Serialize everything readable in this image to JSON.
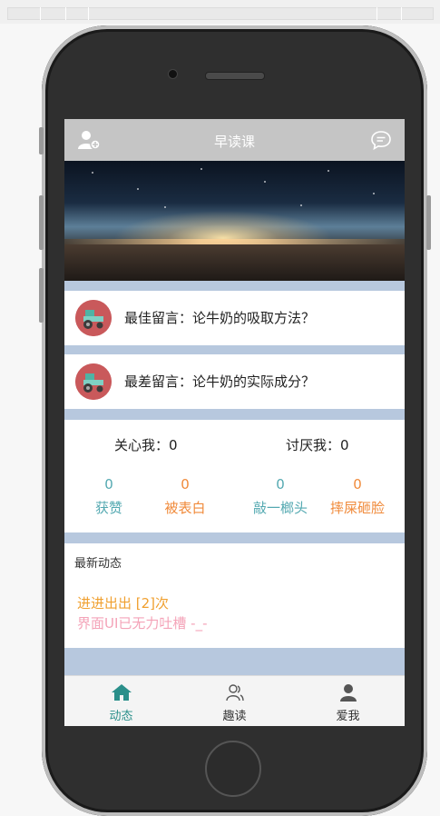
{
  "navbar": {
    "title": "早读课"
  },
  "messages": [
    {
      "label": "最佳留言：论牛奶的吸取方法？"
    },
    {
      "label": "最差留言：论牛奶的实际成分？"
    }
  ],
  "stats": {
    "care_label": "关心我：0",
    "hate_label": "讨厌我：0",
    "items": [
      {
        "value": "0",
        "label": "获赞"
      },
      {
        "value": "0",
        "label": "被表白"
      },
      {
        "value": "0",
        "label": "敲一榔头"
      },
      {
        "value": "0",
        "label": "摔屎砸脸"
      }
    ]
  },
  "news": {
    "title": "最新动态",
    "line1": "进进出出 [2]次",
    "line2": "界面UI已无力吐槽 -_-"
  },
  "tabs": [
    {
      "label": "动态",
      "icon": "home-icon",
      "active": true
    },
    {
      "label": "趣读",
      "icon": "users-icon",
      "active": false
    },
    {
      "label": "爱我",
      "icon": "user-icon",
      "active": false
    }
  ],
  "colors": {
    "accent": "#2a8f8a",
    "teal": "#54a9b1",
    "orange": "#f08a3a",
    "news_orange": "#f0a030",
    "news_pink": "#f4a3b8",
    "divider": "#b7c8de"
  }
}
